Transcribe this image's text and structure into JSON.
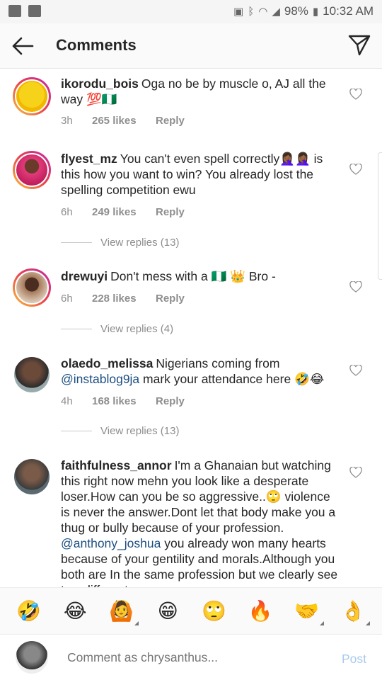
{
  "status_bar": {
    "battery": "98%",
    "time": "10:32 AM"
  },
  "header": {
    "title": "Comments",
    "back_icon": "arrow-left-icon",
    "send_icon": "paper-plane-icon"
  },
  "comments": [
    {
      "username": "ikorodu_bois",
      "text": "Oga no be by muscle o, AJ all the way 💯🇳🇬",
      "time": "3h",
      "likes": "265 likes",
      "reply": "Reply"
    },
    {
      "username": "flyest_mz",
      "text": "You can't even spell correctly🤦🏾‍♀️🤦🏾‍♀️ is this how you want to win? You already lost the spelling competition ewu",
      "time": "6h",
      "likes": "249 likes",
      "reply": "Reply",
      "view_replies": "View replies (13)"
    },
    {
      "username": "drewuyi",
      "text": "Don't mess with a 🇳🇬 👑 Bro -",
      "time": "6h",
      "likes": "228 likes",
      "reply": "Reply",
      "view_replies": "View replies (4)"
    },
    {
      "username": "olaedo_melissa",
      "text_before": "Nigerians coming from ",
      "mention": "@instablog9ja",
      "text_after": " mark your attendance here 🤣😂",
      "time": "4h",
      "likes": "168 likes",
      "reply": "Reply",
      "view_replies": "View replies (13)"
    },
    {
      "username": "faithfulness_annor",
      "text_before": "I'm a Ghanaian but watching this right now mehn you look like a desperate loser.How can you be so aggressive..🙄 violence is never the answer.Dont let that body make you a thug or bully because of your profession. ",
      "mention": "@anthony_joshua",
      "text_after": "  you already won many hearts because of your gentility and morals.Although you both are In the same profession but we clearly see two different"
    }
  ],
  "emoji_bar": [
    "🤣",
    "😂",
    "🙆",
    "😁",
    "🙄",
    "🔥",
    "🤝",
    "👌"
  ],
  "composer": {
    "placeholder": "Comment as chrysanthus...",
    "post_label": "Post"
  }
}
